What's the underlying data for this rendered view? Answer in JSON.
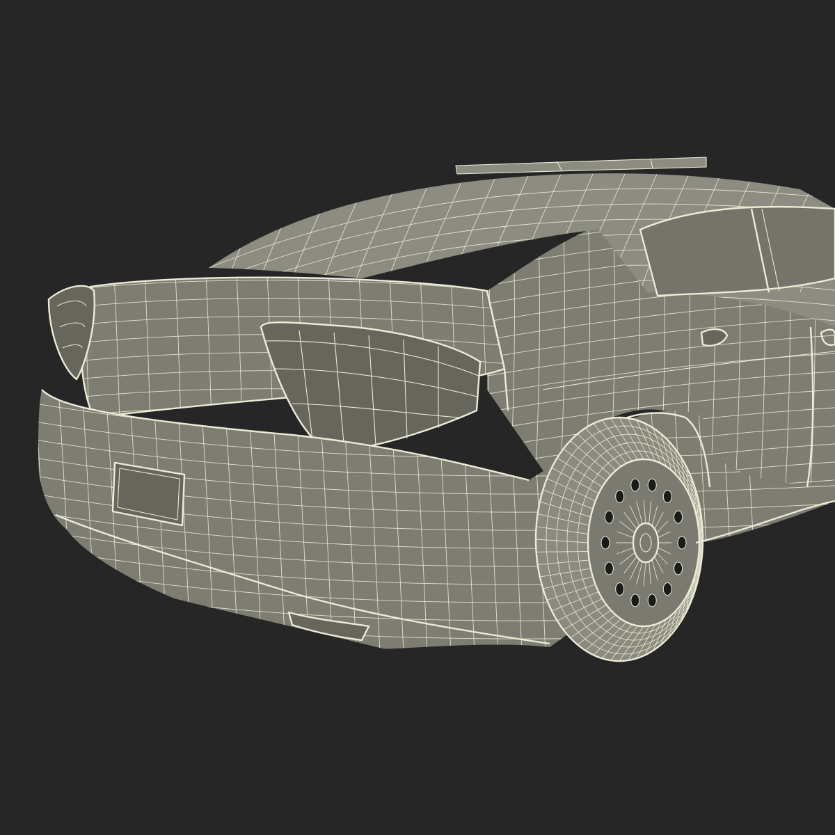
{
  "scene": {
    "subject": "wireframe-police-sedan-rear-three-quarter",
    "colors": {
      "background": "#262626",
      "body_fill": "#7d7d72",
      "body_fill_light": "#8c8c80",
      "body_fill_dark": "#66665d",
      "glass_fill": "#74746a",
      "wire": "#ecebd6",
      "tire": "#8a8a7e",
      "rim": "#7a7a70",
      "shadow": "#1b1b1b"
    }
  }
}
